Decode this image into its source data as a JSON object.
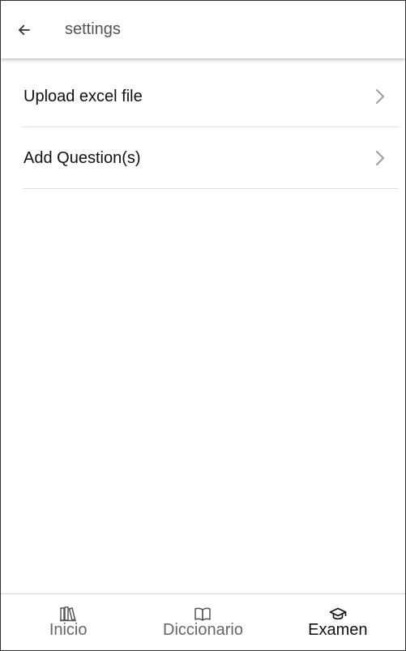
{
  "header": {
    "title": "settings",
    "back_icon": "arrow-left-icon"
  },
  "settings": {
    "items": [
      {
        "label": "Upload excel file",
        "icon": "chevron-right-icon"
      },
      {
        "label": "Add Question(s)",
        "icon": "chevron-right-icon"
      }
    ]
  },
  "bottom_nav": {
    "active_index": 2,
    "items": [
      {
        "label": "Inicio",
        "icon": "library-icon"
      },
      {
        "label": "Diccionario",
        "icon": "book-open-icon"
      },
      {
        "label": "Examen",
        "icon": "graduation-cap-icon"
      }
    ]
  },
  "colors": {
    "header_title": "#555555",
    "item_text": "#111111",
    "nav_inactive": "#666666",
    "nav_active": "#111111",
    "divider": "#e0e0e0"
  }
}
